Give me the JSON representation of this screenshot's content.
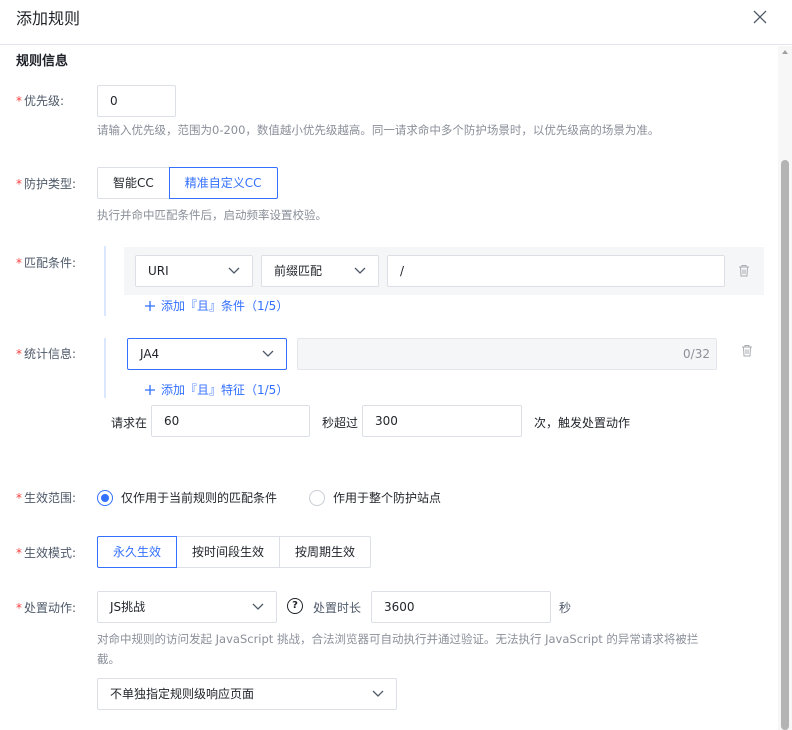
{
  "dialog": {
    "title": "添加规则"
  },
  "section": {
    "title": "规则信息"
  },
  "priority": {
    "label": "优先级:",
    "value": "0",
    "hint": "请输入优先级，范围为0-200，数值越小优先级越高。同一请求命中多个防护场景时，以优先级高的场景为准。"
  },
  "protect_type": {
    "label": "防护类型:",
    "options": [
      "智能CC",
      "精准自定义CC"
    ],
    "selected": 1,
    "hint": "执行并命中匹配条件后，启动频率设置校验。"
  },
  "match": {
    "label": "匹配条件:",
    "field": "URI",
    "operator": "前缀匹配",
    "value": "/",
    "add_link": "添加『且』条件（1/5）"
  },
  "stats": {
    "label": "统计信息:",
    "field": "JA4",
    "value": "",
    "counter": "0/32",
    "add_link": "添加『且』特征（1/5）"
  },
  "rate": {
    "prefix": "请求在",
    "seconds": "60",
    "middle": "秒超过",
    "count": "300",
    "suffix": "次，触发处置动作"
  },
  "scope": {
    "label": "生效范围:",
    "options": [
      "仅作用于当前规则的匹配条件",
      "作用于整个防护站点"
    ],
    "selected": 0
  },
  "mode": {
    "label": "生效模式:",
    "options": [
      "永久生效",
      "按时间段生效",
      "按周期生效"
    ],
    "selected": 0
  },
  "action": {
    "label": "处置动作:",
    "value": "JS挑战",
    "duration_label": "处置时长",
    "duration": "3600",
    "unit": "秒",
    "hint": "对命中规则的访问发起 JavaScript 挑战，合法浏览器可自动执行并通过验证。无法执行 JavaScript 的异常请求将被拦截。",
    "response_page": "不单独指定规则级响应页面"
  },
  "colors": {
    "accent": "#3370ff",
    "required": "#f53f3f"
  },
  "icons": {
    "close": "close-icon",
    "chevron": "chevron-down-icon",
    "trash": "trash-icon",
    "plus": "plus-icon",
    "help": "question-circle-icon"
  }
}
